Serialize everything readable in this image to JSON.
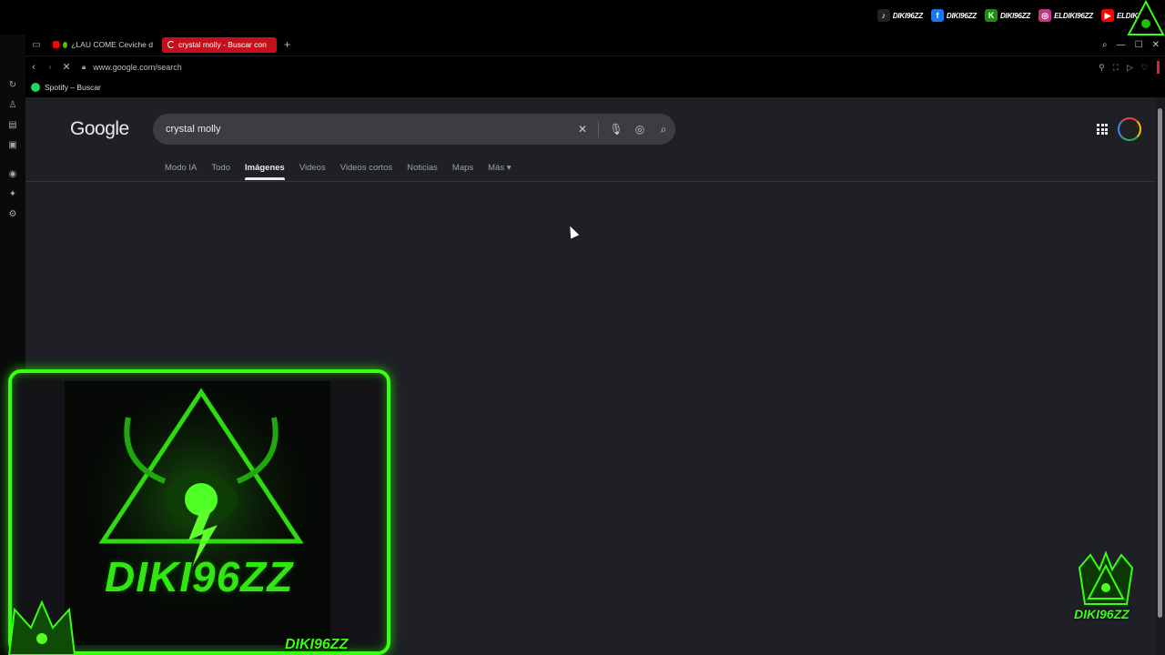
{
  "social": [
    {
      "icon": "tiktok-icon",
      "glyph": "♪",
      "color": "#222",
      "label": "DIKI96ZZ"
    },
    {
      "icon": "facebook-icon",
      "glyph": "f",
      "color": "#1877f2",
      "label": "DIKI96ZZ"
    },
    {
      "icon": "kick-icon",
      "glyph": "K",
      "color": "#1b8f12",
      "label": "DIKI96ZZ"
    },
    {
      "icon": "instagram-icon",
      "glyph": "◎",
      "color": "#c13584",
      "label": "ELDIKI96ZZ"
    },
    {
      "icon": "youtube-icon",
      "glyph": "▶",
      "color": "#ff0000",
      "label": "ELDIKI"
    }
  ],
  "tabs": {
    "inactive_label": "¿LAU COME Ceviche d",
    "active_label": "crystal molly - Buscar con"
  },
  "address": {
    "url": "www.google.com/search"
  },
  "bookmarks": {
    "spotify": "Spotify – Buscar"
  },
  "google": {
    "logo": "Google",
    "query": "crystal molly",
    "tabs": [
      "Modo IA",
      "Todo",
      "Imágenes",
      "Videos",
      "Videos cortos",
      "Noticias",
      "Maps",
      "Más ▾"
    ],
    "active_tab": "Imágenes"
  },
  "overlay": {
    "brand_center": "DIKI96ZZ",
    "cam_name": "DIKI96ZZ",
    "corner_brand": "DIKI96ZZ"
  },
  "colors": {
    "accent_red": "#c4101d",
    "stream_green": "#39ff14"
  }
}
